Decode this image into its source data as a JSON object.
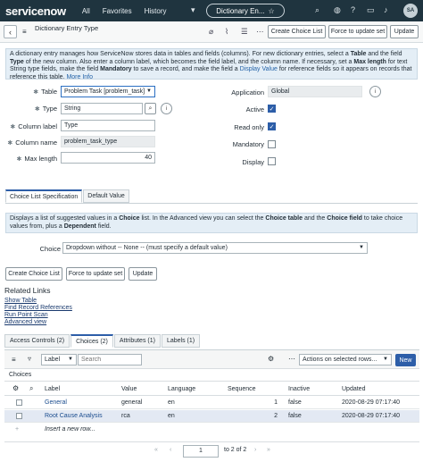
{
  "nav": {
    "brand": "servicenow",
    "links": [
      "All",
      "Favorites",
      "History"
    ],
    "context_title": "Dictionary En...",
    "avatar_initials": "SA"
  },
  "header": {
    "title": "Dictionary Entry Type",
    "buttons": {
      "create_choice_list": "Create Choice List",
      "force_update_set": "Force to update set",
      "update": "Update"
    }
  },
  "info1": {
    "p1": "A dictionary entry manages how ServiceNow stores data in tables and fields (columns). For new dictionary entries, select a ",
    "b1": "Table",
    "p2": " and the field ",
    "b2": "Type",
    "p3": " of the new column. Also enter a column label, which becomes the field label, and the column name. If necessary, set a ",
    "b3": "Max length",
    "p4": " for text String type fields, make the field ",
    "b4": "Mandatory",
    "p5": " to save a record, and make the field a ",
    "l1": "Display Value",
    "p6": " for reference fields so it appears on records that reference this table. ",
    "l2": "More Info"
  },
  "form": {
    "table_label": "Table",
    "table_value": "Problem Task [problem_task]",
    "type_label": "Type",
    "type_value": "String",
    "column_label_label": "Column label",
    "column_label_value": "Type",
    "column_name_label": "Column name",
    "column_name_value": "problem_task_type",
    "max_length_label": "Max length",
    "max_length_value": "40",
    "application_label": "Application",
    "application_value": "Global",
    "active_label": "Active",
    "active": true,
    "read_only_label": "Read only",
    "read_only": true,
    "mandatory_label": "Mandatory",
    "mandatory": false,
    "display_label": "Display",
    "display": false
  },
  "section_tabs": [
    "Choice List Specification",
    "Default Value"
  ],
  "info2": {
    "p1": "Displays a list of suggested values in a ",
    "b1": "Choice",
    "p2": " list. In the Advanced view you can select the ",
    "b2": "Choice table",
    "p3": " and the ",
    "b3": "Choice field",
    "p4": " to take choice values from, plus a ",
    "b4": "Dependent",
    "p5": " field."
  },
  "choice": {
    "label": "Choice",
    "value": "Dropdown without -- None -- (must specify a default value)"
  },
  "bottom_buttons": {
    "create_choice_list": "Create Choice List",
    "force_update_set": "Force to update set",
    "update": "Update"
  },
  "related": {
    "title": "Related Links",
    "links": [
      "Show Table",
      "Find Record References",
      "Run Point Scan",
      "Advanced view"
    ]
  },
  "related_tabs": [
    "Access Controls (2)",
    "Choices (2)",
    "Attributes (1)",
    "Labels (1)"
  ],
  "list": {
    "search_field": "Label",
    "search_placeholder": "Search",
    "actions_label": "Actions on selected rows...",
    "new_label": "New",
    "section_title": "Choices",
    "columns": [
      "Label",
      "Value",
      "Language",
      "Sequence",
      "Inactive",
      "Updated"
    ],
    "rows": [
      {
        "label": "General",
        "value": "general",
        "language": "en",
        "sequence": "1",
        "inactive": "false",
        "updated": "2020-08-29 07:17:40"
      },
      {
        "label": "Root Cause Analysis",
        "value": "rca",
        "language": "en",
        "sequence": "2",
        "inactive": "false",
        "updated": "2020-08-29 07:17:40"
      }
    ],
    "insert_row": "Insert a new row...",
    "pager_current": "1",
    "pager_text": "to 2 of 2"
  }
}
